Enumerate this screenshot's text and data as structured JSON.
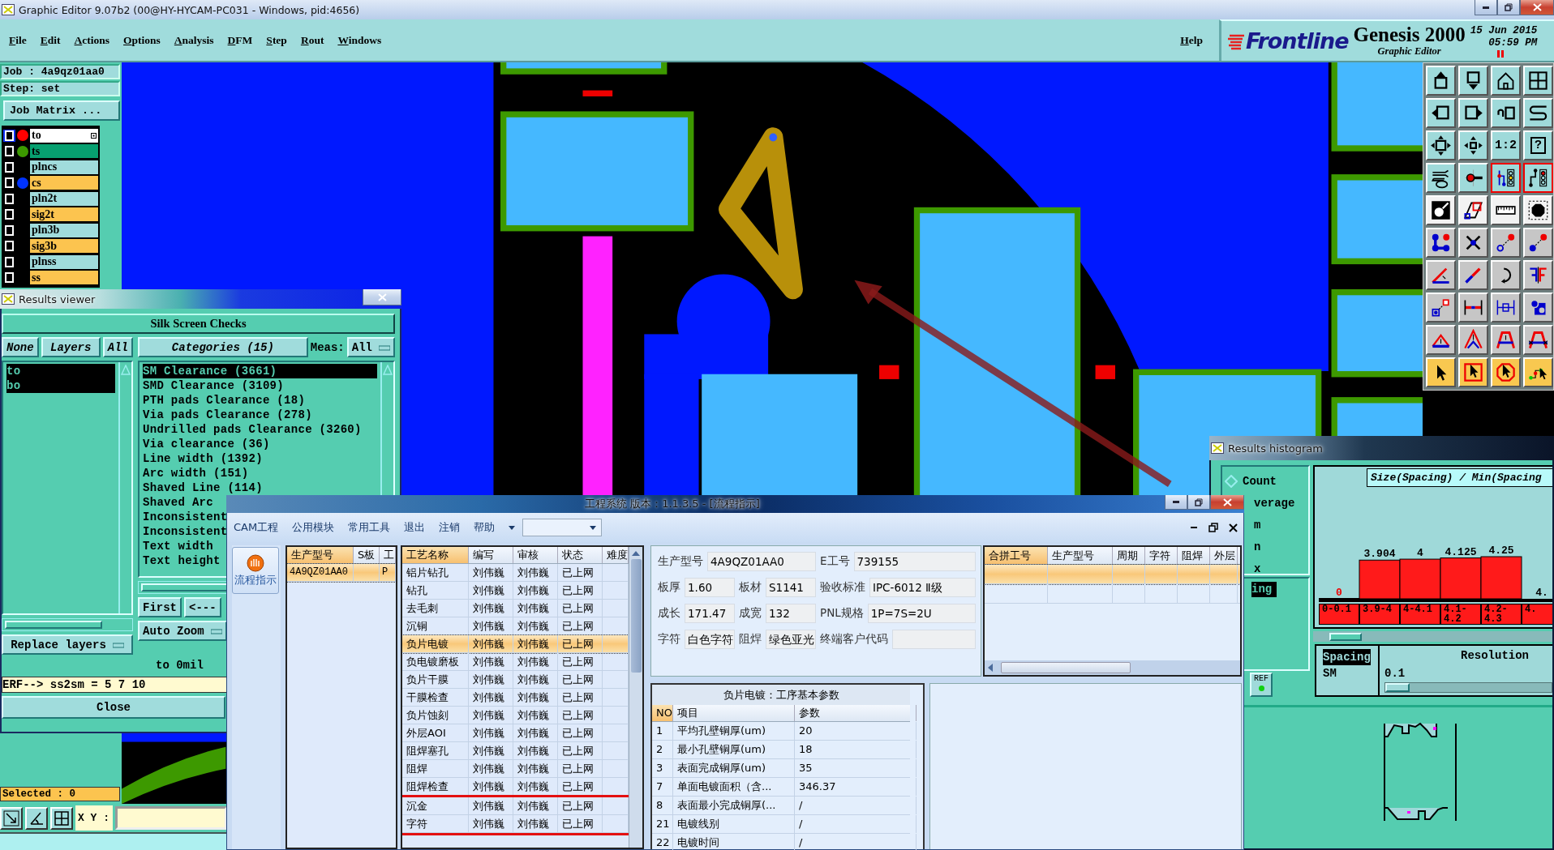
{
  "window": {
    "title": "Graphic Editor 9.07b2 (00@HY-HYCAM-PC031 - Windows, pid:4656)"
  },
  "menu": [
    "File",
    "Edit",
    "Actions",
    "Options",
    "Analysis",
    "DFM",
    "Step",
    "Rout",
    "Windows"
  ],
  "help": "Help",
  "brand": {
    "logo": "Frontline",
    "product": "Genesis 2000",
    "subtitle": "Graphic Editor",
    "date": "15 Jun 2015",
    "time": "05:59 PM"
  },
  "job": {
    "job_label": "Job : 4a9qz01aa0",
    "step_label": "Step: set",
    "matrix_button": "Job Matrix ..."
  },
  "layers": [
    {
      "name": "to",
      "kind": "silk",
      "checked": false,
      "work": true,
      "color": "#ff0000"
    },
    {
      "name": "ts",
      "kind": "mask",
      "checked": false,
      "work": false,
      "color": "#3c9a00"
    },
    {
      "name": "plncs",
      "kind": "plane",
      "checked": false,
      "work": false
    },
    {
      "name": "cs",
      "kind": "signal",
      "checked": false,
      "work": false,
      "color": "#0033ff"
    },
    {
      "name": "pln2t",
      "kind": "plane",
      "checked": false,
      "work": false
    },
    {
      "name": "sig2t",
      "kind": "signal",
      "checked": false,
      "work": false
    },
    {
      "name": "pln3b",
      "kind": "plane",
      "checked": false,
      "work": false
    },
    {
      "name": "sig3b",
      "kind": "signal",
      "checked": false,
      "work": false
    },
    {
      "name": "plnss",
      "kind": "plane",
      "checked": false,
      "work": false
    },
    {
      "name": "ss",
      "kind": "signal",
      "checked": false,
      "work": false
    }
  ],
  "tools": {
    "scale": "1:2",
    "help": "?"
  },
  "bottom": {
    "selected": "Selected : 0",
    "xy_label": "X Y :"
  },
  "viewer": {
    "title": "Results viewer",
    "heading": "Silk Screen Checks",
    "layer_buttons": [
      "None",
      "Layers",
      "All"
    ],
    "categories_button": "Categories (15)",
    "meas_label": "Meas:",
    "meas_value": "All",
    "layers": [
      {
        "name": "to",
        "selected": true
      },
      {
        "name": "bo",
        "selected": true
      }
    ],
    "categories": [
      {
        "label": "SM Clearance (3661)",
        "selected": true
      },
      {
        "label": "SMD Clearance (3109)",
        "selected": false
      },
      {
        "label": "PTH pads Clearance (18)",
        "selected": false
      },
      {
        "label": "Via pads Clearance (278)",
        "selected": false
      },
      {
        "label": "Undrilled pads Clearance (3260)",
        "selected": false
      },
      {
        "label": "Via clearance (36)",
        "selected": false
      },
      {
        "label": "Line width (1392)",
        "selected": false
      },
      {
        "label": "Arc width (151)",
        "selected": false
      },
      {
        "label": "Shaved Line (114)",
        "selected": false
      },
      {
        "label": "Shaved Arc",
        "selected": false
      },
      {
        "label": "Inconsistent",
        "selected": false
      },
      {
        "label": "Inconsistent",
        "selected": false
      },
      {
        "label": "Text width",
        "selected": false
      },
      {
        "label": "Text height",
        "selected": false
      }
    ],
    "nav_buttons": [
      "First",
      "<---"
    ],
    "zoom_mode": "Auto Zoom",
    "replace_mode": "Replace layers",
    "status": "to 0mil",
    "erf_line": "ERF--> ss2sm = 5 7 10",
    "close": "Close"
  },
  "histogram": {
    "title": "Results histogram",
    "options": [
      {
        "label": "Count",
        "selected": false
      },
      {
        "label": "verage"
      },
      {
        "label": "m"
      },
      {
        "label": "n"
      },
      {
        "label": "x"
      }
    ],
    "types": [
      {
        "label": "ing",
        "selected": true
      }
    ],
    "ref_button": "REF",
    "chart_data": {
      "type": "bar",
      "title": "Size(Spacing) / Min(Spacing",
      "categories": [
        "0-0.1",
        "3.9-4",
        "4-4.1",
        "4.1-4.2",
        "4.2-4.3",
        "4."
      ],
      "values": [
        0,
        3.904,
        4,
        4.125,
        4.25,
        null
      ],
      "value_labels": [
        "0",
        "3.904",
        "4",
        "4.125",
        "4.25",
        "4."
      ]
    },
    "measures": [
      {
        "label": "Spacing",
        "selected": true
      },
      {
        "label": "SM",
        "selected": false
      }
    ],
    "resolution": {
      "label": "Resolution",
      "value": "0.1",
      "level": 0
    }
  },
  "dialog": {
    "title": "工程系统   版本：1.1.3.5 - [流程指示]",
    "menu": [
      "CAM工程",
      "公用模块",
      "常用工具",
      "退出",
      "注销",
      "帮助"
    ],
    "nav_button": "流程指示",
    "job_grid": {
      "columns": [
        {
          "label": "生产型号",
          "selected": true
        },
        {
          "label": "S板",
          "selected": false
        },
        {
          "label": "工",
          "selected": false
        }
      ],
      "rows": [
        {
          "cells": [
            "4A9QZ01AA0",
            "",
            "P"
          ],
          "selected": true
        }
      ]
    },
    "process_grid": {
      "columns": [
        {
          "label": "工艺名称",
          "selected": true
        },
        {
          "label": "编写",
          "selected": false
        },
        {
          "label": "审核",
          "selected": false
        },
        {
          "label": "状态",
          "selected": false
        },
        {
          "label": "难度",
          "selected": false
        }
      ],
      "rows": [
        {
          "cells": [
            "铝片钻孔",
            "刘伟巍",
            "刘伟巍",
            "已上网"
          ],
          "selected": false,
          "marked": false
        },
        {
          "cells": [
            "钻孔",
            "刘伟巍",
            "刘伟巍",
            "已上网"
          ],
          "selected": false,
          "marked": false
        },
        {
          "cells": [
            "去毛刺",
            "刘伟巍",
            "刘伟巍",
            "已上网"
          ],
          "selected": false,
          "marked": false
        },
        {
          "cells": [
            "沉铜",
            "刘伟巍",
            "刘伟巍",
            "已上网"
          ],
          "selected": false,
          "marked": false
        },
        {
          "cells": [
            "负片电镀",
            "刘伟巍",
            "刘伟巍",
            "已上网"
          ],
          "selected": true,
          "marked": false
        },
        {
          "cells": [
            "负电镀磨板",
            "刘伟巍",
            "刘伟巍",
            "已上网"
          ],
          "selected": false,
          "marked": false
        },
        {
          "cells": [
            "负片干膜",
            "刘伟巍",
            "刘伟巍",
            "已上网"
          ],
          "selected": false,
          "marked": false
        },
        {
          "cells": [
            "干膜检查",
            "刘伟巍",
            "刘伟巍",
            "已上网"
          ],
          "selected": false,
          "marked": false
        },
        {
          "cells": [
            "负片蚀刻",
            "刘伟巍",
            "刘伟巍",
            "已上网"
          ],
          "selected": false,
          "marked": false
        },
        {
          "cells": [
            "外层AOI",
            "刘伟巍",
            "刘伟巍",
            "已上网"
          ],
          "selected": false,
          "marked": false
        },
        {
          "cells": [
            "阻焊塞孔",
            "刘伟巍",
            "刘伟巍",
            "已上网"
          ],
          "selected": false,
          "marked": false
        },
        {
          "cells": [
            "阻焊",
            "刘伟巍",
            "刘伟巍",
            "已上网"
          ],
          "selected": false,
          "marked": false
        },
        {
          "cells": [
            "阻焊检查",
            "刘伟巍",
            "刘伟巍",
            "已上网"
          ],
          "selected": false,
          "marked": false
        },
        {
          "cells": [
            "沉金",
            "刘伟巍",
            "刘伟巍",
            "已上网"
          ],
          "selected": false,
          "marked": true
        },
        {
          "cells": [
            "字符",
            "刘伟巍",
            "刘伟巍",
            "已上网"
          ],
          "selected": false,
          "marked": true
        }
      ]
    },
    "info": [
      [
        {
          "label": "生产型号",
          "value": "4A9QZ01AA0"
        },
        {
          "label": "E工号",
          "value": "739155"
        }
      ],
      [
        {
          "label": "板厚",
          "value": "1.60"
        },
        {
          "label": "板材",
          "value": "S1141"
        },
        {
          "label": "验收标准",
          "value": "IPC-6012 Ⅱ级"
        }
      ],
      [
        {
          "label": "成长",
          "value": "171.47"
        },
        {
          "label": "成宽",
          "value": "132"
        },
        {
          "label": "PNL规格",
          "value": "1P=7S=2U"
        }
      ],
      [
        {
          "label": "字符",
          "value": "白色字符"
        },
        {
          "label": "阻焊",
          "value": "绿色亚光"
        },
        {
          "label": "终端客户代码"
        }
      ]
    ],
    "merge_grid": {
      "columns": [
        {
          "label": "合拼工号",
          "selected": true
        },
        {
          "label": "生产型号",
          "selected": false
        },
        {
          "label": "周期",
          "selected": false
        },
        {
          "label": "字符",
          "selected": false
        },
        {
          "label": "阻焊",
          "selected": false
        },
        {
          "label": "外层",
          "selected": false
        }
      ],
      "rows": [
        {
          "selected": true
        },
        {
          "selected": false
        }
      ]
    },
    "params": {
      "title": "负片电镀：工序基本参数",
      "columns": [
        {
          "label": "NO",
          "selected": true
        },
        {
          "label": "项目",
          "selected": false
        },
        {
          "label": "参数",
          "selected": false
        }
      ],
      "rows": [
        [
          "1",
          "平均孔壁铜厚(um)",
          "20"
        ],
        [
          "2",
          "最小孔壁铜厚(um)",
          "18"
        ],
        [
          "3",
          "表面完成铜厚(um)",
          "35"
        ],
        [
          "7",
          "单面电镀面积（含...",
          "346.37"
        ],
        [
          "8",
          "表面最小完成铜厚(...",
          "/"
        ],
        [
          "21",
          "电镀线别",
          "/"
        ],
        [
          "22",
          "电镀时间",
          "/"
        ]
      ]
    }
  }
}
